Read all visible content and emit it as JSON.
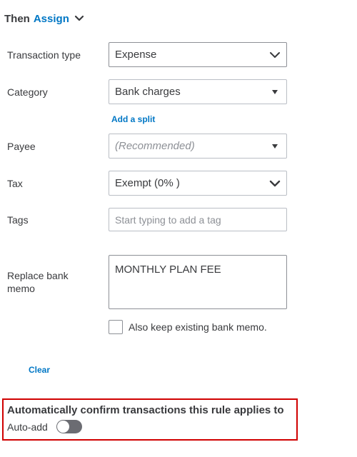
{
  "header": {
    "then_label": "Then",
    "assign_label": "Assign"
  },
  "fields": {
    "transaction_type": {
      "label": "Transaction type",
      "value": "Expense"
    },
    "category": {
      "label": "Category",
      "value": "Bank charges"
    },
    "add_split_label": "Add a split",
    "payee": {
      "label": "Payee",
      "placeholder": "(Recommended)"
    },
    "tax": {
      "label": "Tax",
      "value": "Exempt (0% )"
    },
    "tags": {
      "label": "Tags",
      "placeholder": "Start typing to add a tag"
    },
    "memo": {
      "label_line1": "Replace bank",
      "label_line2": "memo",
      "value": "MONTHLY PLAN FEE"
    },
    "keep_memo": {
      "label": "Also keep existing bank memo.",
      "checked": false
    }
  },
  "clear_label": "Clear",
  "auto_confirm": {
    "title": "Automatically confirm transactions this rule applies to",
    "toggle_label": "Auto-add",
    "enabled": false,
    "highlight_color": "#d00000"
  },
  "colors": {
    "link": "#0077c5",
    "text": "#393a3d",
    "toggle_off": "#6b6c72"
  }
}
